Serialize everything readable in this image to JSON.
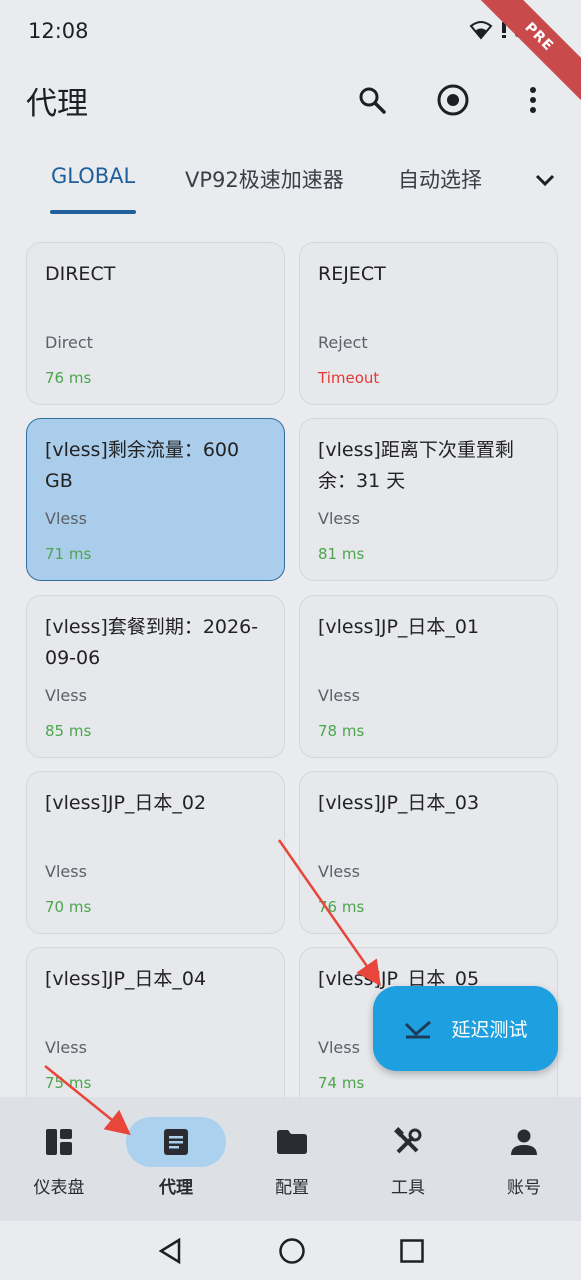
{
  "status_bar": {
    "time": "12:08",
    "ribbon": "PRE"
  },
  "appbar": {
    "title": "代理",
    "icons": [
      "search-icon",
      "target-icon",
      "more-vert-icon"
    ]
  },
  "tabs": {
    "items": [
      {
        "label": "GLOBAL",
        "active": true
      },
      {
        "label": "VP92极速加速器",
        "active": false
      },
      {
        "label": "自动选择",
        "active": false
      }
    ],
    "more_icon": "chevron-down-icon"
  },
  "proxies": [
    {
      "name": "DIRECT",
      "type": "Direct",
      "delay": "76 ms",
      "status": "ok",
      "selected": false
    },
    {
      "name": "REJECT",
      "type": "Reject",
      "delay": "Timeout",
      "status": "timeout",
      "selected": false
    },
    {
      "name": "[vless]剩余流量：600 GB",
      "type": "Vless",
      "delay": "71 ms",
      "status": "ok",
      "selected": true
    },
    {
      "name": "[vless]距离下次重置剩余：31 天",
      "type": "Vless",
      "delay": "81 ms",
      "status": "ok",
      "selected": false
    },
    {
      "name": "[vless]套餐到期：2026-09-06",
      "type": "Vless",
      "delay": "85 ms",
      "status": "ok",
      "selected": false
    },
    {
      "name": "[vless]JP_日本_01",
      "type": "Vless",
      "delay": "78 ms",
      "status": "ok",
      "selected": false
    },
    {
      "name": "[vless]JP_日本_02",
      "type": "Vless",
      "delay": "70 ms",
      "status": "ok",
      "selected": false
    },
    {
      "name": "[vless]JP_日本_03",
      "type": "Vless",
      "delay": "76 ms",
      "status": "ok",
      "selected": false
    },
    {
      "name": "[vless]JP_日本_04",
      "type": "Vless",
      "delay": "75 ms",
      "status": "ok",
      "selected": false
    },
    {
      "name": "[vless]JP_日本_05",
      "type": "Vless",
      "delay": "74 ms",
      "status": "ok",
      "selected": false
    }
  ],
  "fab": {
    "label": "延迟测试",
    "icon": "speed-test-icon"
  },
  "bottom_nav": [
    {
      "label": "仪表盘",
      "icon": "dashboard-icon",
      "active": false
    },
    {
      "label": "代理",
      "icon": "list-icon",
      "active": true
    },
    {
      "label": "配置",
      "icon": "folder-icon",
      "active": false
    },
    {
      "label": "工具",
      "icon": "tools-icon",
      "active": false
    },
    {
      "label": "账号",
      "icon": "person-icon",
      "active": false
    }
  ],
  "colors": {
    "accent": "#20609a",
    "selected_card": "#aacdeb",
    "fab": "#1d9fe0",
    "delay_ok": "#4ca64c",
    "delay_timeout": "#e53935",
    "annotation_arrow": "#e8463a"
  }
}
